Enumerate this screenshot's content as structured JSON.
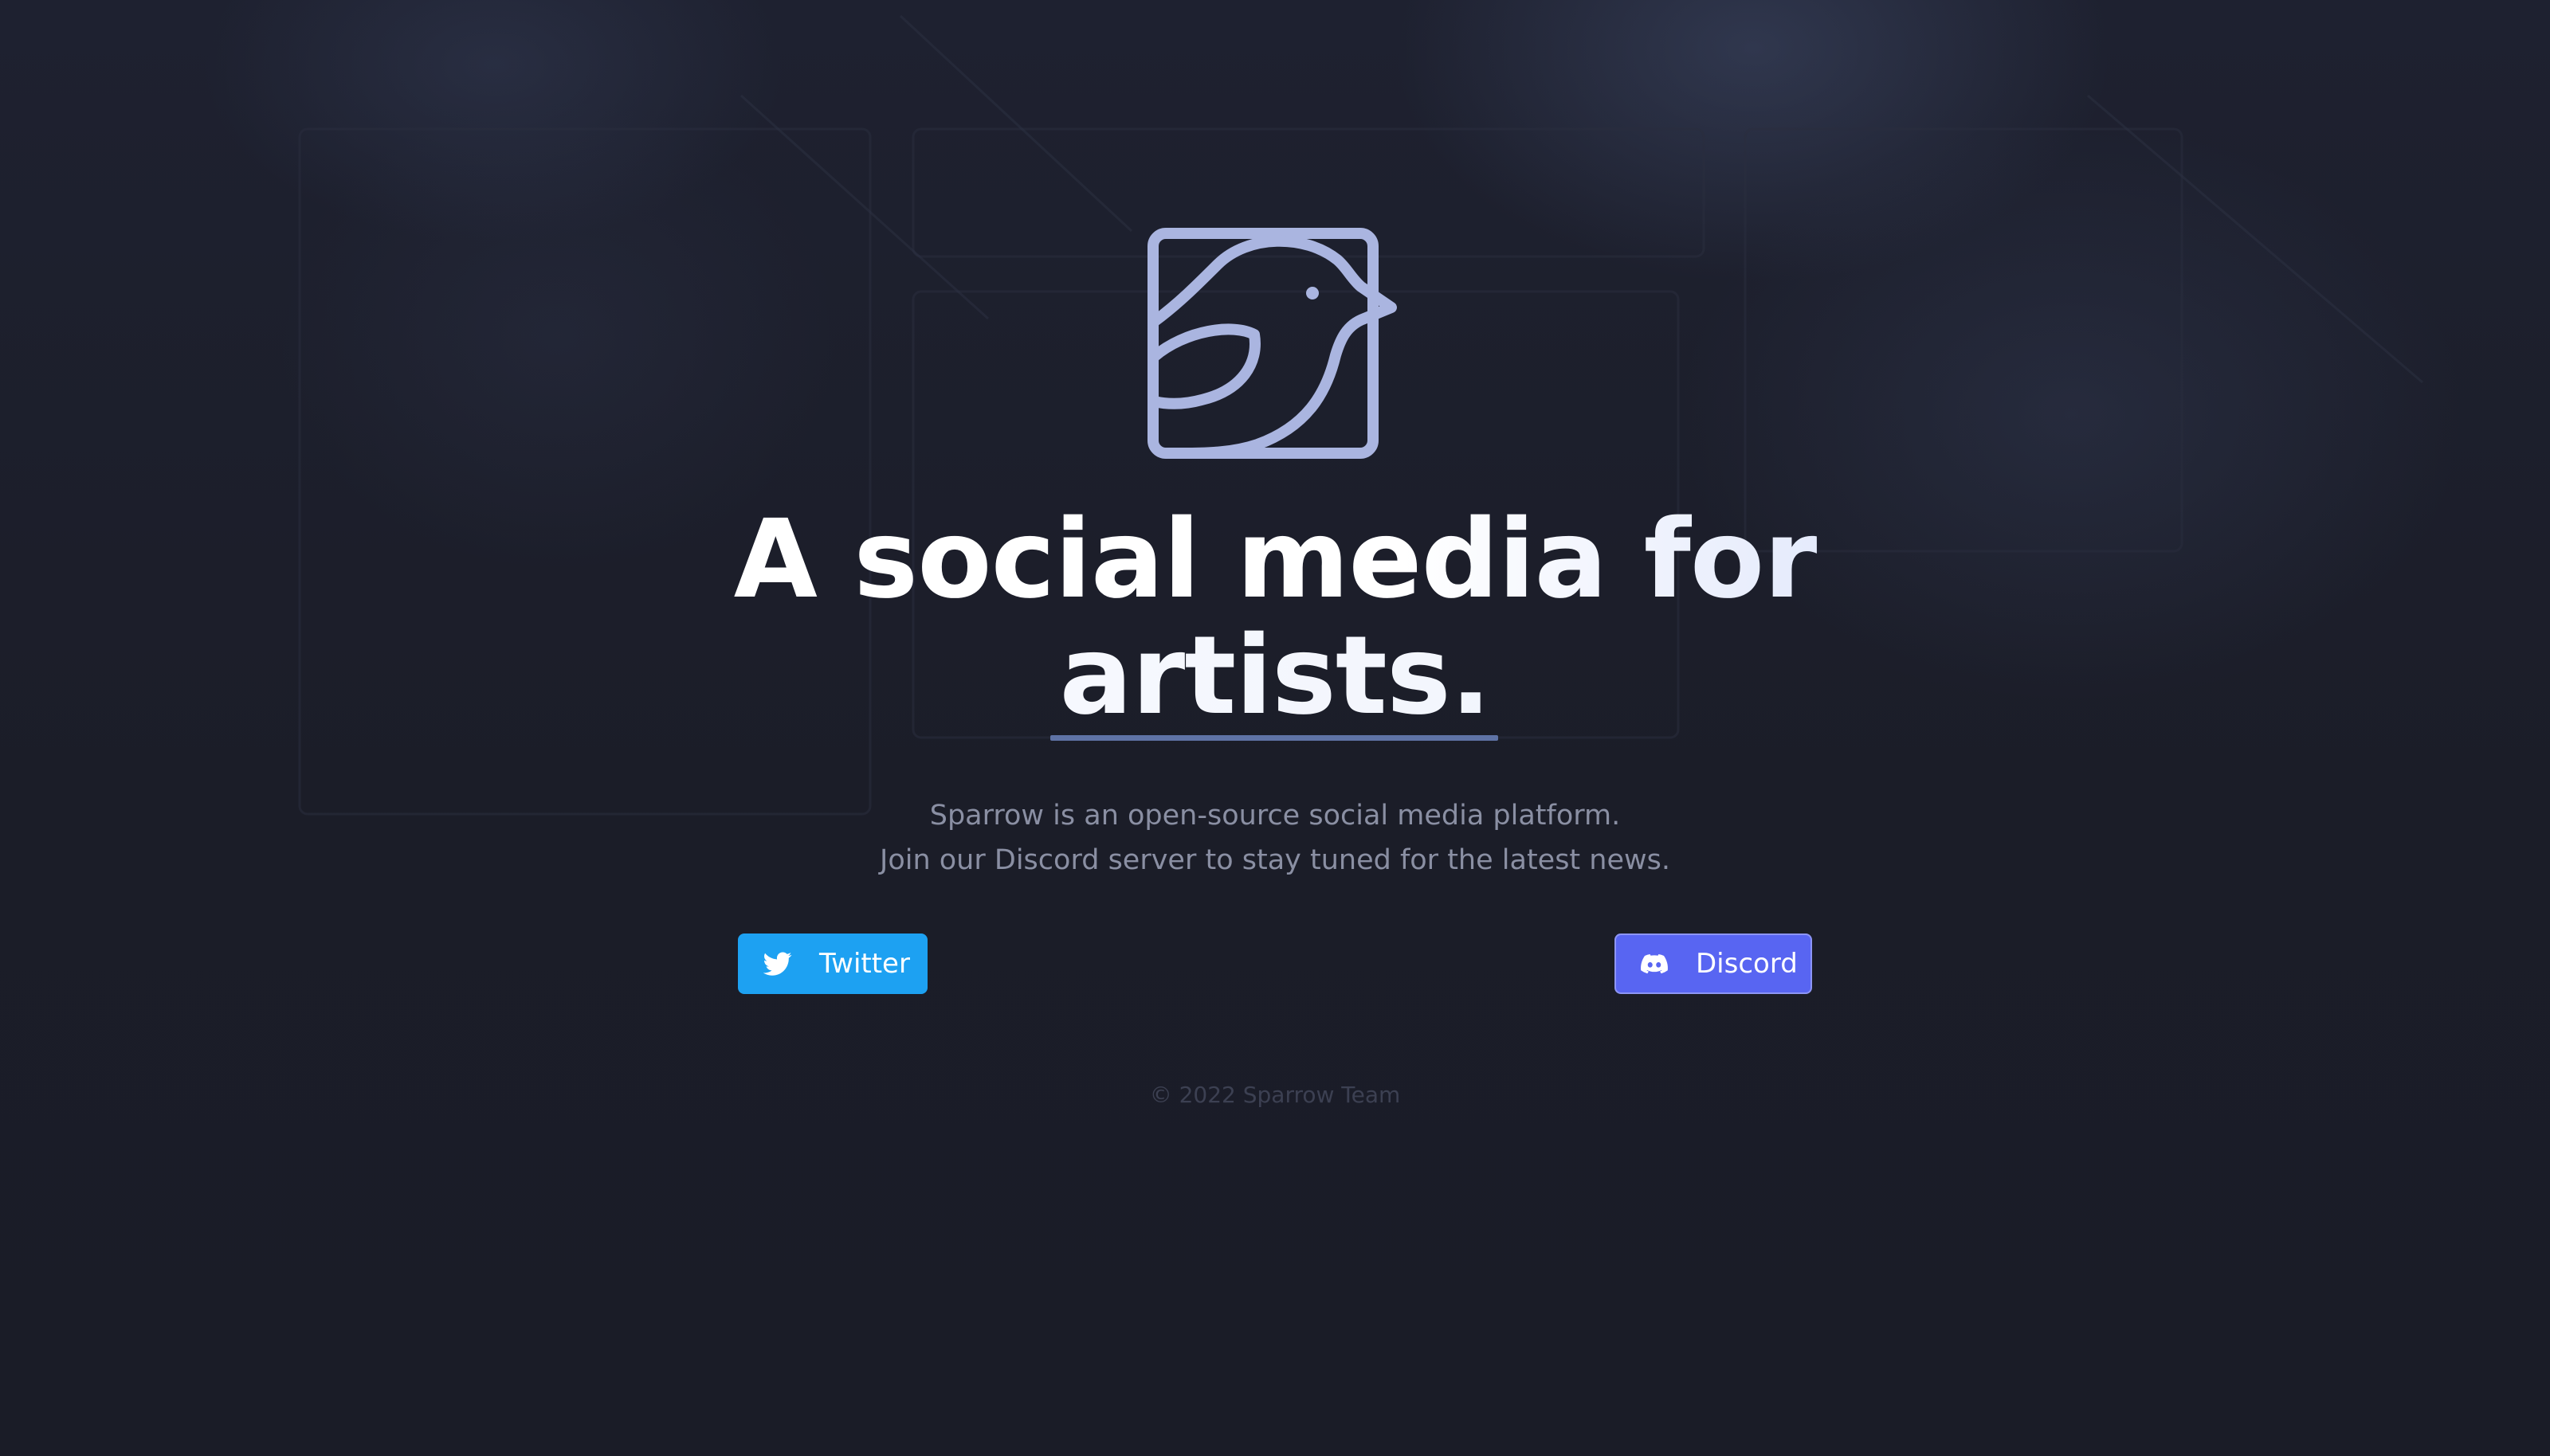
{
  "brand": {
    "logo": "sparrow-bird-logo-icon",
    "accent_color": "#aab5e0",
    "underline_color": "#5f73a6"
  },
  "hero": {
    "headline_line1": "A social media for",
    "headline_line2": "artists.",
    "subtitle_line1": "Sparrow is an open-source social media platform.",
    "subtitle_line2": "Join our Discord server to stay tuned for the latest news."
  },
  "buttons": {
    "twitter": {
      "label": "Twitter",
      "icon": "twitter-icon",
      "color": "#1da1f2"
    },
    "discord": {
      "label": "Discord",
      "icon": "discord-icon",
      "color": "#5865f2"
    }
  },
  "footer": {
    "copyright": "© 2022 Sparrow Team"
  }
}
